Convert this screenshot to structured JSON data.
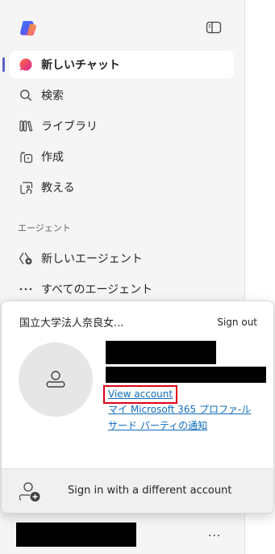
{
  "sidebar": {
    "items": [
      {
        "label": "新しいチャット",
        "icon": "copilot-chat-bubble-icon"
      },
      {
        "label": "検索",
        "icon": "search-icon"
      },
      {
        "label": "ライブラリ",
        "icon": "library-icon"
      },
      {
        "label": "作成",
        "icon": "create-icon"
      },
      {
        "label": "教える",
        "icon": "teach-icon"
      }
    ],
    "agents_section_label": "エージェント",
    "agent_items": [
      {
        "label": "新しいエージェント",
        "icon": "new-agent-icon"
      },
      {
        "label": "すべてのエージェント",
        "icon": "more-horizontal-icon"
      }
    ]
  },
  "account_popup": {
    "org_name": "国立大学法人奈良女...",
    "sign_out_label": "Sign out",
    "view_account_label": "View account",
    "profile_link_label": "マイ Microsoft 365 プロファ‐ル",
    "third_party_link_label": "サード パーティの通知",
    "other_account_label": "Sign in with a different account"
  },
  "bottom_bar": {
    "more_label": "..."
  },
  "colors": {
    "sidebar_bg": "#f5f5f5",
    "link": "#0f6cbd",
    "highlight_box": "#e0001b",
    "active_indicator": "#5b5fc7"
  }
}
